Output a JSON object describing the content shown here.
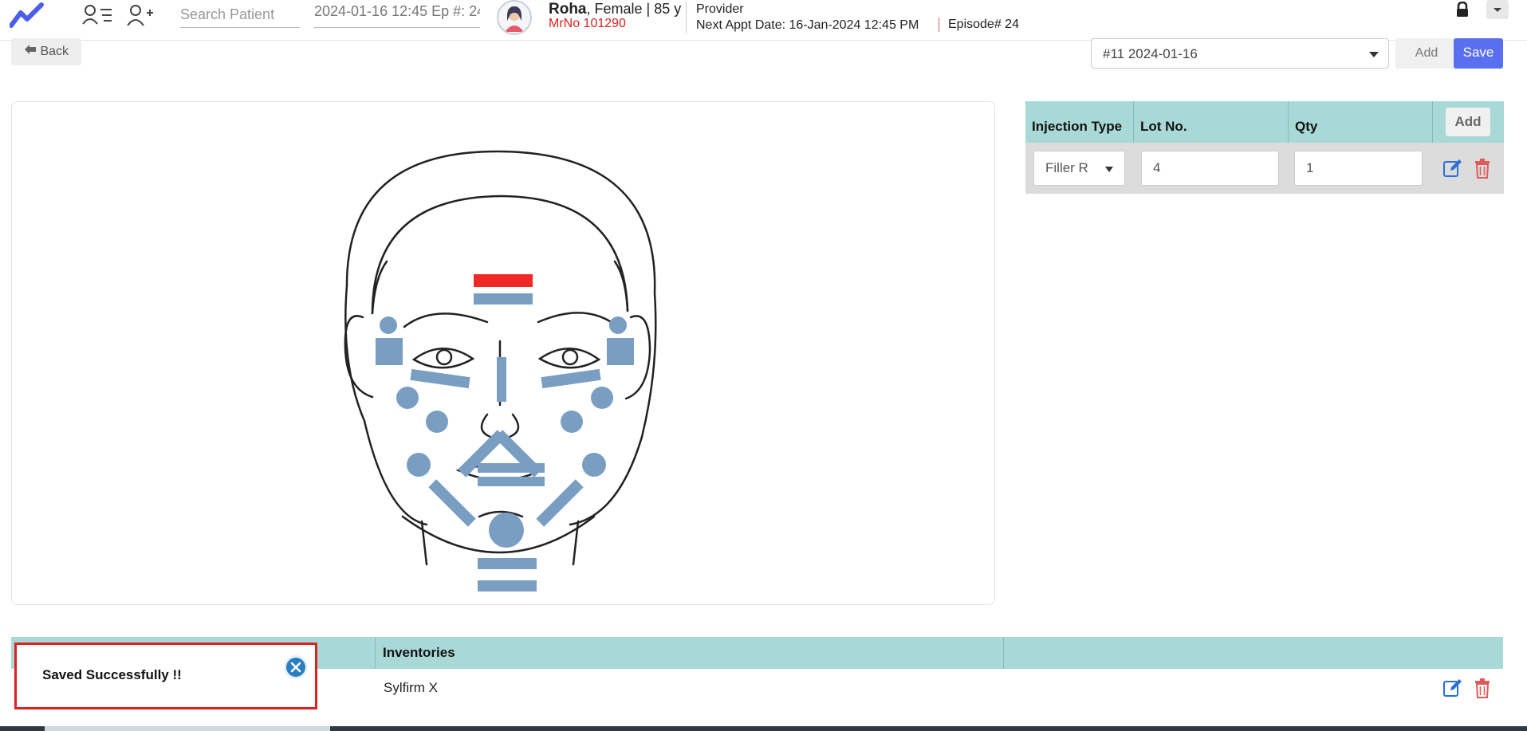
{
  "header": {
    "search_placeholder": "Search Patient",
    "episode_info": "2024-01-16 12:45 Ep #: 24",
    "patient_name": "Roha",
    "patient_details": ", Female | 85 y",
    "mrno": "MrNo 101290",
    "provider_label": "Provider",
    "next_appt_label": "Next Appt Date",
    "next_appt_value": ": 16-Jan-2024 12:45 PM",
    "episode_no": "Episode# 24"
  },
  "toolbar": {
    "back_label": "Back",
    "visit_selected": "#11 2024-01-16",
    "add_label": "Add",
    "save_label": "Save"
  },
  "injection_table": {
    "columns": [
      "Injection Type",
      "Lot No.",
      "Qty"
    ],
    "add_label": "Add",
    "rows": [
      {
        "type": "Filler R",
        "lot": "4",
        "qty": "1"
      }
    ]
  },
  "inventory_table": {
    "columns": [
      "Inventories"
    ],
    "rows": [
      {
        "name": "Sylfirm X"
      }
    ]
  },
  "toast": {
    "message": "Saved Successfully !!"
  },
  "colors": {
    "accent": "#5a6ef0",
    "table_header": "#a9d9d6",
    "marker": "#7a9ec2",
    "marker_selected": "#f02828",
    "error": "#e02020"
  }
}
